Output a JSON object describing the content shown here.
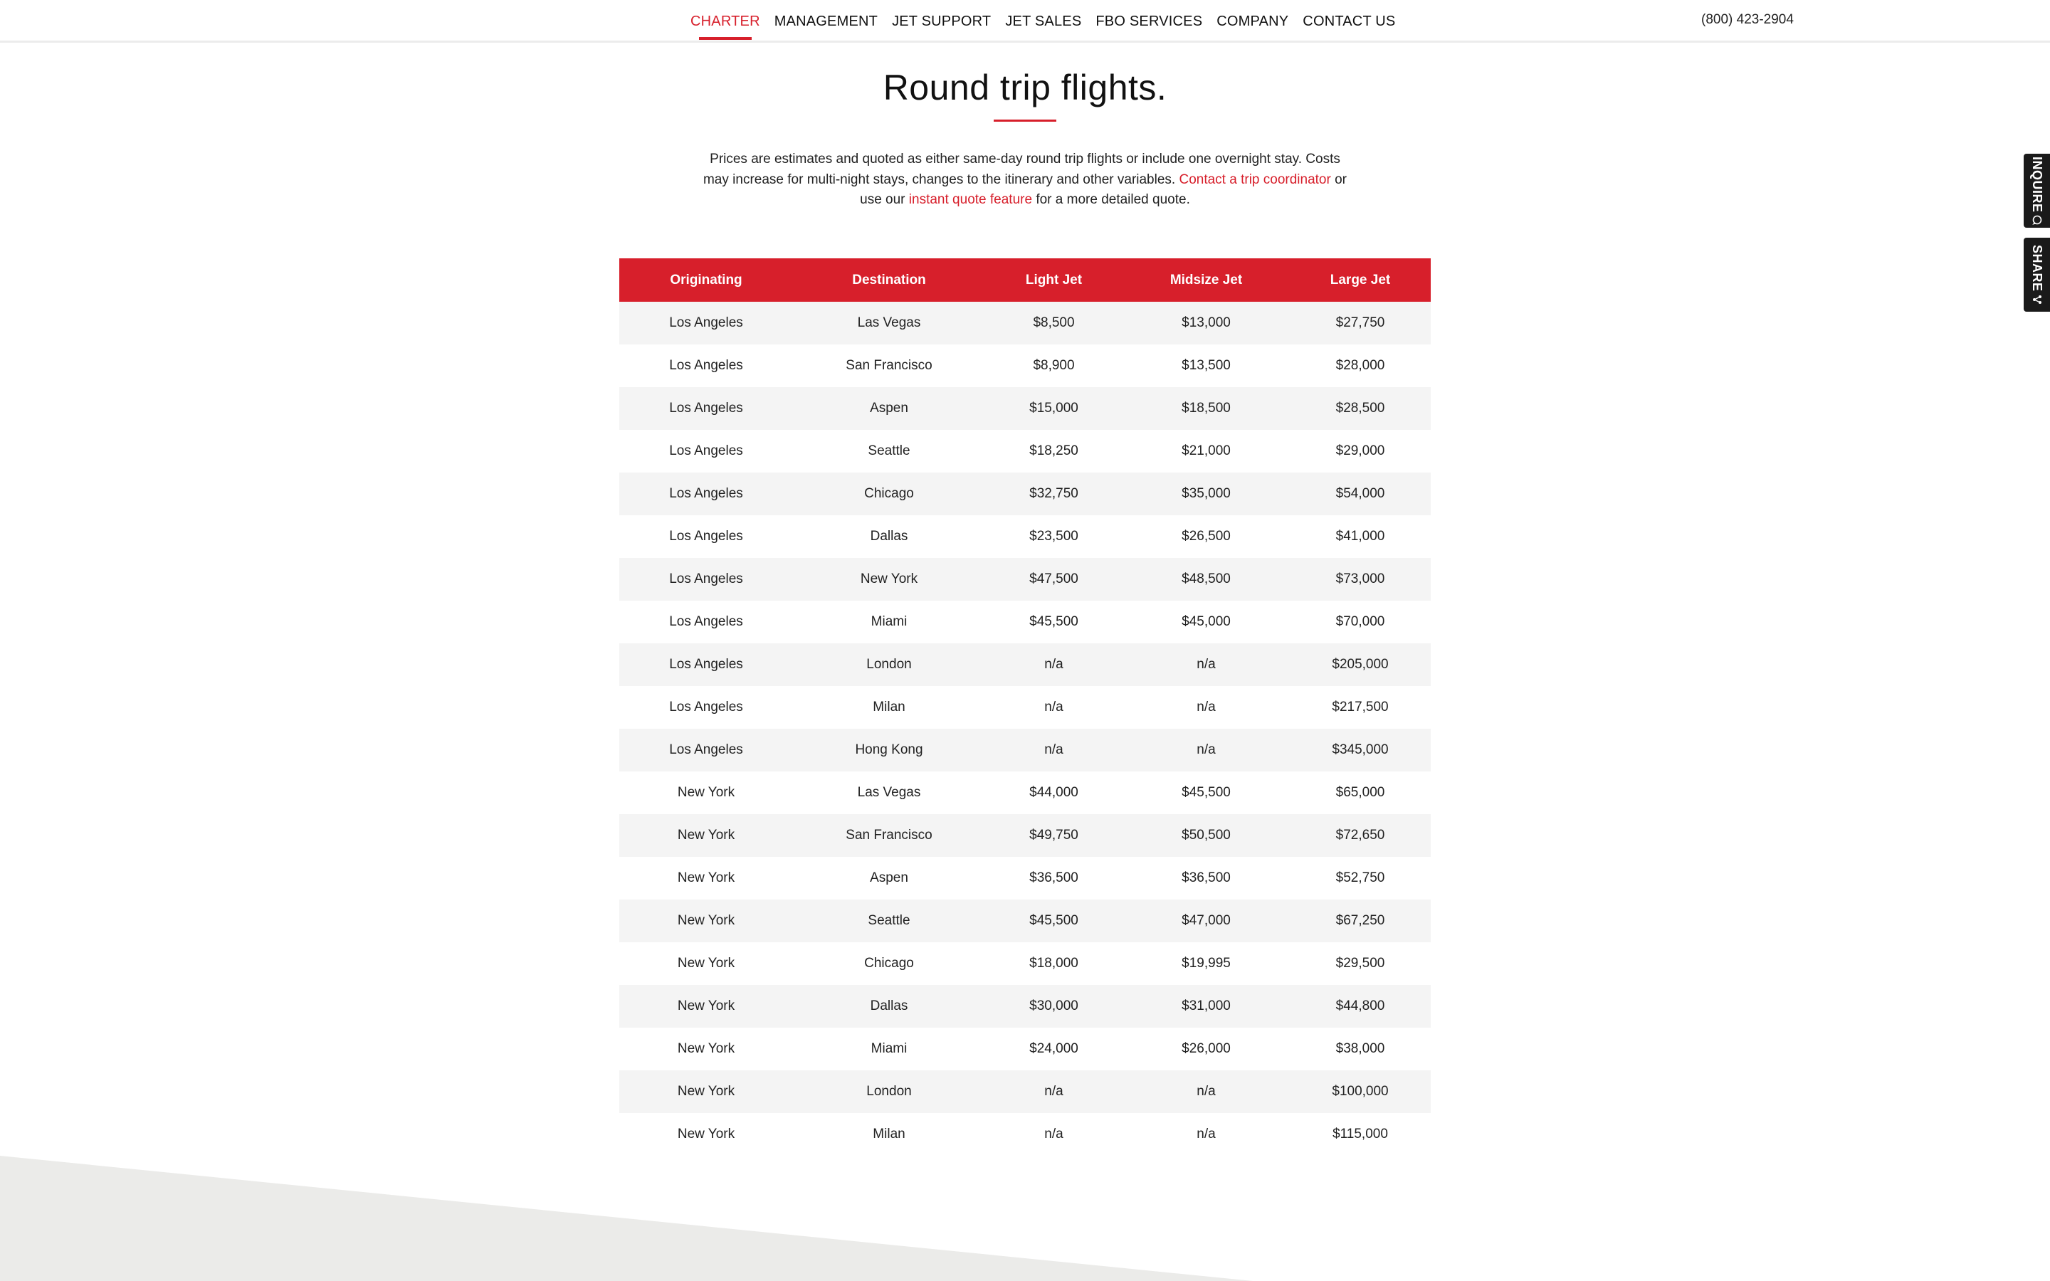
{
  "nav": {
    "items": [
      {
        "label": "CHARTER",
        "active": true
      },
      {
        "label": "MANAGEMENT",
        "active": false
      },
      {
        "label": "JET SUPPORT",
        "active": false
      },
      {
        "label": "JET SALES",
        "active": false
      },
      {
        "label": "FBO SERVICES",
        "active": false
      },
      {
        "label": "COMPANY",
        "active": false
      },
      {
        "label": "CONTACT US",
        "active": false
      }
    ],
    "phone": "(800) 423-2904"
  },
  "page": {
    "title": "Round trip flights.",
    "intro_before_link1": "Prices are estimates and quoted as either same-day round trip flights or include one overnight stay. Costs may increase for multi-night stays, changes to the itinerary and other variables. ",
    "link1": "Contact a trip coordinator",
    "intro_between": " or use our ",
    "link2": "instant quote feature",
    "intro_after": " for a more detailed quote."
  },
  "table": {
    "headers": [
      "Originating",
      "Destination",
      "Light Jet",
      "Midsize Jet",
      "Large Jet"
    ],
    "rows": [
      [
        "Los Angeles",
        "Las Vegas",
        "$8,500",
        "$13,000",
        "$27,750"
      ],
      [
        "Los Angeles",
        "San Francisco",
        "$8,900",
        "$13,500",
        "$28,000"
      ],
      [
        "Los Angeles",
        "Aspen",
        "$15,000",
        "$18,500",
        "$28,500"
      ],
      [
        "Los Angeles",
        "Seattle",
        "$18,250",
        "$21,000",
        "$29,000"
      ],
      [
        "Los Angeles",
        "Chicago",
        "$32,750",
        "$35,000",
        "$54,000"
      ],
      [
        "Los Angeles",
        "Dallas",
        "$23,500",
        "$26,500",
        "$41,000"
      ],
      [
        "Los Angeles",
        "New York",
        "$47,500",
        "$48,500",
        "$73,000"
      ],
      [
        "Los Angeles",
        "Miami",
        "$45,500",
        "$45,000",
        "$70,000"
      ],
      [
        "Los Angeles",
        "London",
        "n/a",
        "n/a",
        "$205,000"
      ],
      [
        "Los Angeles",
        "Milan",
        "n/a",
        "n/a",
        "$217,500"
      ],
      [
        "Los Angeles",
        "Hong Kong",
        "n/a",
        "n/a",
        "$345,000"
      ],
      [
        "New York",
        "Las Vegas",
        "$44,000",
        "$45,500",
        "$65,000"
      ],
      [
        "New York",
        "San Francisco",
        "$49,750",
        "$50,500",
        "$72,650"
      ],
      [
        "New York",
        "Aspen",
        "$36,500",
        "$36,500",
        "$52,750"
      ],
      [
        "New York",
        "Seattle",
        "$45,500",
        "$47,000",
        "$67,250"
      ],
      [
        "New York",
        "Chicago",
        "$18,000",
        "$19,995",
        "$29,500"
      ],
      [
        "New York",
        "Dallas",
        "$30,000",
        "$31,000",
        "$44,800"
      ],
      [
        "New York",
        "Miami",
        "$24,000",
        "$26,000",
        "$38,000"
      ],
      [
        "New York",
        "London",
        "n/a",
        "n/a",
        "$100,000"
      ],
      [
        "New York",
        "Milan",
        "n/a",
        "n/a",
        "$115,000"
      ]
    ]
  },
  "side_tabs": {
    "inquire": "INQUIRE",
    "inquire_icon": "chat-bubble-icon",
    "share": "SHARE",
    "share_icon": "share-icon"
  },
  "colors": {
    "accent": "#d71f2b",
    "row_stripe": "#f4f4f4",
    "side_tab_bg": "#1a1a1a",
    "bottom_band": "#ebebe9"
  }
}
